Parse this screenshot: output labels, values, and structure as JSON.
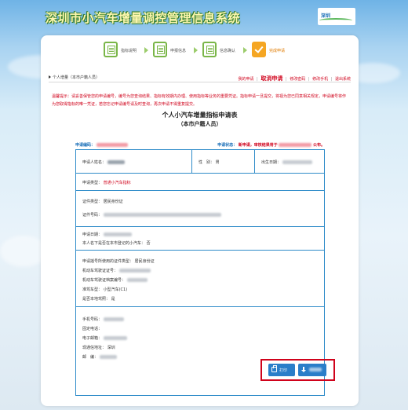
{
  "header": {
    "site_title": "深圳市小汽车增量调控管理信息系统",
    "logo_text": "深圳"
  },
  "steps": [
    {
      "label": "指标说明"
    },
    {
      "label": "申报信息"
    },
    {
      "label": "信息确认"
    },
    {
      "label": "完成申请"
    }
  ],
  "topbar": {
    "section": "个人增量（本市户籍人员）",
    "links": [
      "我的申请",
      "取消申请",
      "修改密码",
      "修改手机",
      "退出系统"
    ]
  },
  "notice": "温馨提示：请妥善保管您的申请编号，编号为您查询结果、指标有效期内办理、使用指标等业务的重要凭证。指标申请一旦提交，将视为您已同意相关规定，申请编号将作为您取得指标的唯一凭证，若您忘记申请编号请及时查询，再次申请不得重复提交。",
  "form": {
    "title": "个人小汽车增量指标申请表",
    "subtitle": "（本市户籍人员）",
    "app_no_label": "申请编码：",
    "status_label": "申请状态：",
    "status_value": "新申请，审核结果将于",
    "status_tail": "公布。",
    "applicant_name_label": "申请人姓名：",
    "applicant_name_value": "张三",
    "gender_label": "性　别：",
    "gender_value": "男",
    "birth_label": "出生日期：",
    "apply_type_label": "申请类型：",
    "apply_type_value": "普通小汽车指标",
    "id_type_label": "证件类型：",
    "id_type_value": "居民身份证",
    "id_no_label": "证件号码：",
    "apply_date_label": "申请日期：",
    "own_car_label": "本人名下是否在本市登记的小汽车：",
    "own_car_value": "否",
    "license_doc_label": "申请摇号所使用的证件类型：",
    "license_doc_value": "居民身份证",
    "license_no_label": "机动车驾驶证证号：",
    "license_file_label": "机动车驾驶证档案编号：",
    "license_class_label": "准驾车型：",
    "license_class_value": "小型汽车(C1)",
    "license_valid_label": "是否本地驾照：",
    "license_valid_value": "是",
    "mobile_label": "手机号码：",
    "phone_label": "固定电话：",
    "email_label": "电子邮箱：",
    "address_label": "现通信地址：",
    "address_value": "深圳",
    "postcode_label": "邮　编："
  },
  "actions": {
    "print_label": "打印",
    "download_label": "下载"
  }
}
